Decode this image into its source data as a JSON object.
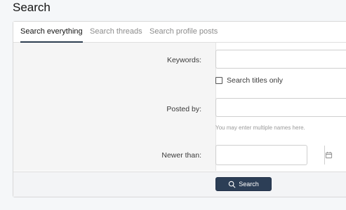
{
  "page": {
    "title": "Search"
  },
  "tabs": [
    {
      "label": "Search everything",
      "active": true
    },
    {
      "label": "Search threads",
      "active": false
    },
    {
      "label": "Search profile posts",
      "active": false
    }
  ],
  "form": {
    "keywords": {
      "label": "Keywords:",
      "value": "",
      "placeholder": ""
    },
    "titles_only": {
      "label": "Search titles only",
      "checked": false
    },
    "posted_by": {
      "label": "Posted by:",
      "value": "",
      "hint": "You may enter multiple names here."
    },
    "newer_than": {
      "label": "Newer than:",
      "value": "",
      "icon": "calendar-icon"
    }
  },
  "footer": {
    "search_label": "Search",
    "search_icon": "search-icon"
  },
  "colors": {
    "accent": "#2c3e56",
    "tab_active_underline": "#2d3e50"
  }
}
